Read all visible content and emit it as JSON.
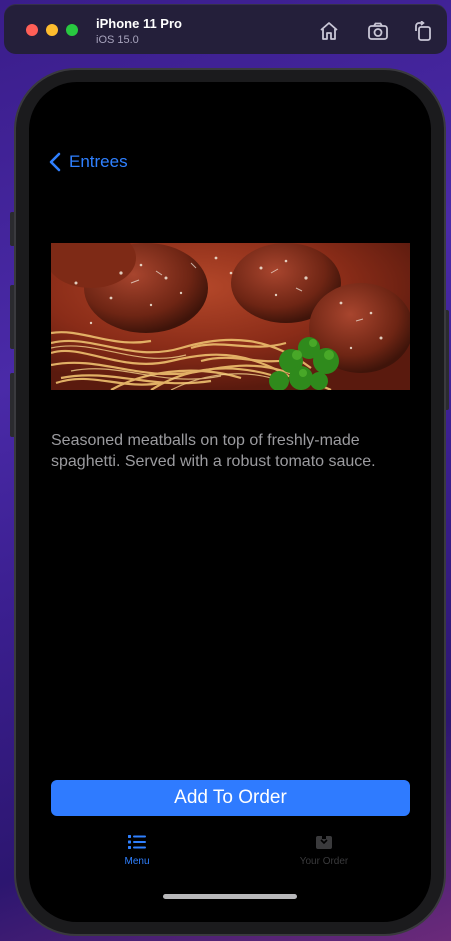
{
  "simulator": {
    "device_name": "iPhone 11 Pro",
    "os_version": "iOS 15.0",
    "toolbar": [
      "home-icon",
      "screenshot-icon",
      "rotate-icon"
    ]
  },
  "nav": {
    "back_label": "Entrees"
  },
  "item": {
    "image": "spaghetti-meatballs-photo",
    "description": "Seasoned meatballs on top of freshly-made spaghetti. Served with a robust tomato sauce."
  },
  "actions": {
    "add_to_order": "Add To Order"
  },
  "tabbar": {
    "tabs": [
      {
        "label": "Menu",
        "icon": "list-icon",
        "active": true
      },
      {
        "label": "Your Order",
        "icon": "order-tray-icon",
        "active": false
      }
    ]
  },
  "colors": {
    "accent": "#2f7bff",
    "screen_bg": "#000000",
    "description_text": "#9b9b9f",
    "inactive_tab": "#3a3a3c"
  }
}
